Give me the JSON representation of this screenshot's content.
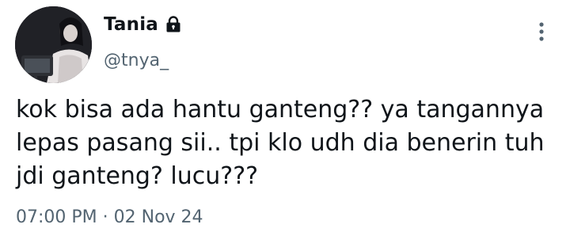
{
  "tweet": {
    "display_name": "Tania",
    "handle": "@tnya_",
    "text": "kok bisa ada hantu ganteng?? ya tangannya\nlepas pasang sii.. tpi klo udh dia benerin tuh\njdi ganteng? lucu???",
    "timestamp": "07:00 PM · 02 Nov 24",
    "icons": {
      "lock": "lock-icon",
      "more": "more-options-icon"
    }
  },
  "colors": {
    "text_primary": "#0f1419",
    "text_secondary": "#536471",
    "background": "#ffffff"
  }
}
